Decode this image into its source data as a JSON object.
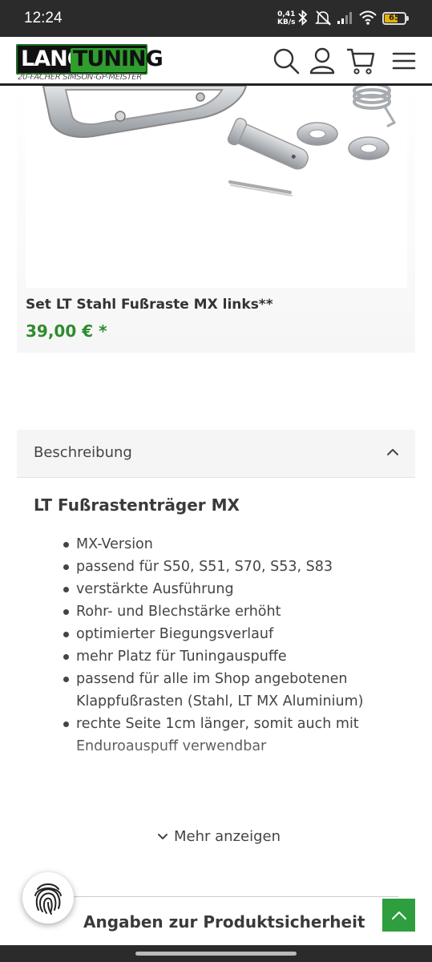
{
  "status_bar": {
    "time": "12:24",
    "net_speed_value": "0,41",
    "net_speed_unit": "KB/s",
    "battery": "65"
  },
  "header": {
    "logo_word1": "LANG",
    "logo_word2": "TUNING",
    "logo_tagline": "20-FACHER SIMSON-GP-MEISTER",
    "icons": [
      "search-icon",
      "account-icon",
      "cart-icon",
      "menu-icon"
    ]
  },
  "product_card": {
    "title": "Set LT Stahl Fußraste MX links**",
    "price": "39,00 € *"
  },
  "accordion": {
    "label": "Beschreibung",
    "state": "expanded"
  },
  "description": {
    "title": "LT Fußrastenträger MX",
    "features": [
      "MX-Version",
      "passend für S50, S51, S70, S53, S83",
      "verstärkte Ausführung",
      "Rohr- und Blechstärke erhöht",
      "optimierter Biegungsverlauf",
      "mehr Platz für Tuningauspuffe",
      "passend für alle im Shop angebotenen Klappfußrasten (Stahl, LT MX Aluminium)",
      "rechte Seite 1cm länger, somit auch mit Enduroauspuff verwendbar"
    ],
    "show_more": "Mehr anzeigen"
  },
  "product_safety": {
    "title": "Angaben zur Produktsicherheit"
  },
  "colors": {
    "brand_green": "#2e9e3e",
    "price_green": "#2e8b2e",
    "status_bar": "#2b2b2b"
  }
}
